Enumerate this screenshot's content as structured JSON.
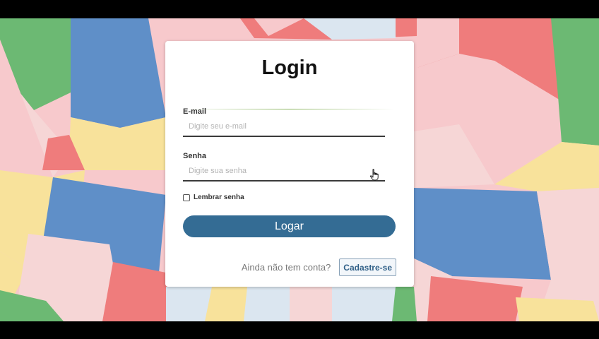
{
  "login": {
    "title": "Login",
    "email": {
      "label": "E-mail",
      "placeholder": "Digite seu e-mail",
      "value": ""
    },
    "password": {
      "label": "Senha",
      "placeholder": "Digite sua senha",
      "value": ""
    },
    "remember": {
      "label": "Lembrar senha",
      "checked": false
    },
    "submit_label": "Logar",
    "signup_prompt": "Ainda não tem conta?",
    "signup_label": "Cadastre-se"
  },
  "colors": {
    "primary_button": "#346c94",
    "divider_accent": "#8ab55e",
    "background_blue": "#5f8fc8",
    "background_pink": "#f7c9cc",
    "background_red": "#ef7c7c",
    "background_green": "#6cb973",
    "background_yellow": "#f8e29b"
  },
  "icons": {
    "cursor": "hand-pointer-icon"
  }
}
